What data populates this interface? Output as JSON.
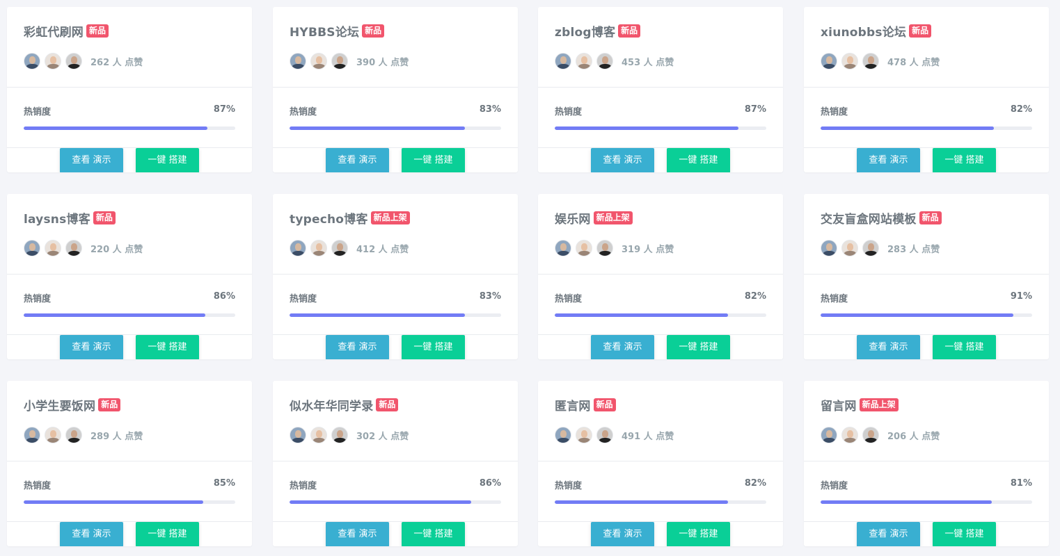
{
  "colors": {
    "badge": "#f1556c",
    "progress": "#727cf5",
    "demo_button": "#39afd1",
    "build_button": "#0acf97"
  },
  "cards": [
    {
      "title": "彩虹代刷网",
      "badge": "新品",
      "likes": "262 人 点赞",
      "hot_label": "热销度",
      "hot_value": "87%",
      "hot_fraction": 0.87,
      "demo_label": "查看 演示",
      "build_label": "一键 搭建"
    },
    {
      "title": "HYBBS论坛",
      "badge": "新品",
      "likes": "390 人 点赞",
      "hot_label": "热销度",
      "hot_value": "83%",
      "hot_fraction": 0.83,
      "demo_label": "查看 演示",
      "build_label": "一键 搭建"
    },
    {
      "title": "zblog博客",
      "badge": "新品",
      "likes": "453 人 点赞",
      "hot_label": "热销度",
      "hot_value": "87%",
      "hot_fraction": 0.87,
      "demo_label": "查看 演示",
      "build_label": "一键 搭建"
    },
    {
      "title": "xiunobbs论坛",
      "badge": "新品",
      "likes": "478 人 点赞",
      "hot_label": "热销度",
      "hot_value": "82%",
      "hot_fraction": 0.82,
      "demo_label": "查看 演示",
      "build_label": "一键 搭建"
    },
    {
      "title": "laysns博客",
      "badge": "新品",
      "likes": "220 人 点赞",
      "hot_label": "热销度",
      "hot_value": "86%",
      "hot_fraction": 0.86,
      "demo_label": "查看 演示",
      "build_label": "一键 搭建"
    },
    {
      "title": "typecho博客",
      "badge": "新品上架",
      "likes": "412 人 点赞",
      "hot_label": "热销度",
      "hot_value": "83%",
      "hot_fraction": 0.83,
      "demo_label": "查看 演示",
      "build_label": "一键 搭建"
    },
    {
      "title": "娱乐网",
      "badge": "新品上架",
      "likes": "319 人 点赞",
      "hot_label": "热销度",
      "hot_value": "82%",
      "hot_fraction": 0.82,
      "demo_label": "查看 演示",
      "build_label": "一键 搭建"
    },
    {
      "title": "交友盲盒网站模板",
      "badge": "新品",
      "likes": "283 人 点赞",
      "hot_label": "热销度",
      "hot_value": "91%",
      "hot_fraction": 0.91,
      "demo_label": "查看 演示",
      "build_label": "一键 搭建"
    },
    {
      "title": "小学生要饭网",
      "badge": "新品",
      "likes": "289 人 点赞",
      "hot_label": "热销度",
      "hot_value": "85%",
      "hot_fraction": 0.85,
      "demo_label": "查看 演示",
      "build_label": "一键 搭建"
    },
    {
      "title": "似水年华同学录",
      "badge": "新品",
      "likes": "302 人 点赞",
      "hot_label": "热销度",
      "hot_value": "86%",
      "hot_fraction": 0.86,
      "demo_label": "查看 演示",
      "build_label": "一键 搭建"
    },
    {
      "title": "匿言网",
      "badge": "新品",
      "likes": "491 人 点赞",
      "hot_label": "热销度",
      "hot_value": "82%",
      "hot_fraction": 0.82,
      "demo_label": "查看 演示",
      "build_label": "一键 搭建"
    },
    {
      "title": "留言网",
      "badge": "新品上架",
      "likes": "206 人 点赞",
      "hot_label": "热销度",
      "hot_value": "81%",
      "hot_fraction": 0.81,
      "demo_label": "查看 演示",
      "build_label": "一键 搭建"
    }
  ]
}
